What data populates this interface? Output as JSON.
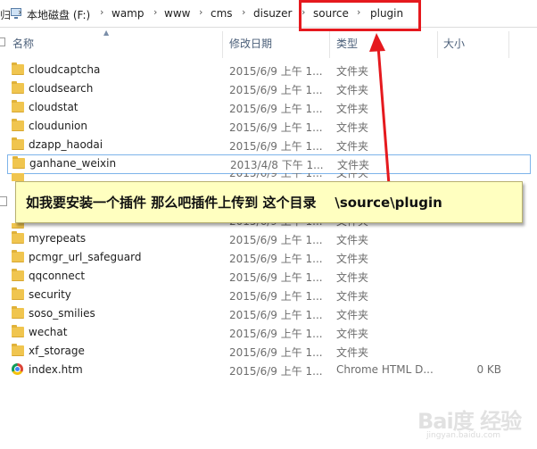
{
  "address_bar": {
    "left_edge_glyph": "归",
    "segments": [
      "本地磁盘 (F:)",
      "wamp",
      "www",
      "cms",
      "disuzer",
      "source",
      "plugin"
    ],
    "separator": "›"
  },
  "columns": {
    "name": "名称",
    "modified": "修改日期",
    "type": "类型",
    "size": "大小"
  },
  "files": [
    {
      "name": "cloudcaptcha",
      "modified": "2015/6/9 上午 1...",
      "type": "文件夹",
      "size": "",
      "icon": "folder-icon"
    },
    {
      "name": "cloudsearch",
      "modified": "2015/6/9 上午 1...",
      "type": "文件夹",
      "size": "",
      "icon": "folder-icon"
    },
    {
      "name": "cloudstat",
      "modified": "2015/6/9 上午 1...",
      "type": "文件夹",
      "size": "",
      "icon": "folder-icon"
    },
    {
      "name": "cloudunion",
      "modified": "2015/6/9 上午 1...",
      "type": "文件夹",
      "size": "",
      "icon": "folder-icon"
    },
    {
      "name": "dzapp_haodai",
      "modified": "2015/6/9 上午 1...",
      "type": "文件夹",
      "size": "",
      "icon": "folder-icon"
    },
    {
      "name": "ganhane_weixin",
      "modified": "2013/4/8 下午 1...",
      "type": "文件夹",
      "size": "",
      "icon": "folder-icon",
      "selected": true
    },
    {
      "name": "myrepeats",
      "modified": "2015/6/9 上午 1...",
      "type": "文件夹",
      "size": "",
      "icon": "folder-icon"
    },
    {
      "name": "pcmgr_url_safeguard",
      "modified": "2015/6/9 上午 1...",
      "type": "文件夹",
      "size": "",
      "icon": "folder-icon"
    },
    {
      "name": "qqconnect",
      "modified": "2015/6/9 上午 1...",
      "type": "文件夹",
      "size": "",
      "icon": "folder-icon"
    },
    {
      "name": "security",
      "modified": "2015/6/9 上午 1...",
      "type": "文件夹",
      "size": "",
      "icon": "folder-icon"
    },
    {
      "name": "soso_smilies",
      "modified": "2015/6/9 上午 1...",
      "type": "文件夹",
      "size": "",
      "icon": "folder-icon"
    },
    {
      "name": "wechat",
      "modified": "2015/6/9 上午 1...",
      "type": "文件夹",
      "size": "",
      "icon": "folder-icon"
    },
    {
      "name": "xf_storage",
      "modified": "2015/6/9 上午 1...",
      "type": "文件夹",
      "size": "",
      "icon": "folder-icon"
    },
    {
      "name": "index.htm",
      "modified": "2015/6/9 上午 1...",
      "type": "Chrome HTML D...",
      "size": "0 KB",
      "icon": "chrome-icon"
    }
  ],
  "callout": {
    "text": "如我要安装一个插件 那么吧插件上传到 这个目录    \\source\\plugin"
  },
  "annotation_color": "#e5191e",
  "watermark": {
    "brand": "Bai度 经验",
    "url": "jingyan.baidu.com"
  }
}
